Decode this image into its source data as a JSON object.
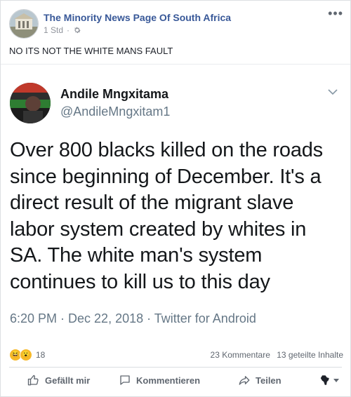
{
  "post": {
    "page_name": "The Minority News Page Of South Africa",
    "time": "1 Std",
    "privacy_icon": "gear-icon",
    "more_icon": "ellipsis-icon",
    "caption": "NO ITS NOT THE WHITE MANS FAULT"
  },
  "tweet": {
    "name": "Andile Mngxitama",
    "handle": "@AndileMngxitam1",
    "text": "Over 800 blacks killed on the roads since beginning of December. It's a direct result of the migrant slave labor system created by whites in SA. The white man's system continues to kill us to this day",
    "timestamp": "6:20 PM · Dec 22, 2018 · Twitter for Android"
  },
  "stats": {
    "reaction_icons": [
      "laughing-emoji-icon",
      "wow-emoji-icon"
    ],
    "reaction_count": "18",
    "comments": "23 Kommentare",
    "shares": "13 geteilte Inhalte"
  },
  "actions": {
    "like": "Gefällt mir",
    "comment": "Kommentieren",
    "share": "Teilen",
    "audience_icon": "africa-globe-icon"
  },
  "colors": {
    "link": "#385898",
    "muted": "#606770",
    "twitter_muted": "#657786"
  }
}
